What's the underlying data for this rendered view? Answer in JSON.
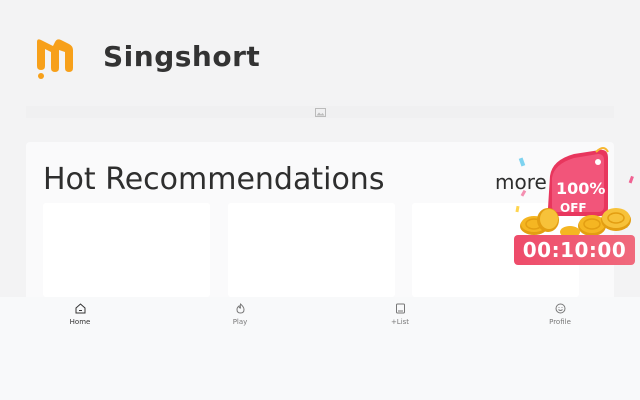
{
  "app": {
    "name": "Singshort"
  },
  "section": {
    "title": "Hot Recommendations",
    "more_label": "more"
  },
  "promo": {
    "discount": "100%",
    "off_label": "OFF",
    "timer": "00:10:00"
  },
  "tabs": [
    {
      "label": "Home",
      "icon": "home-icon",
      "active": true
    },
    {
      "label": "Play",
      "icon": "flame-icon",
      "active": false
    },
    {
      "label": "+List",
      "icon": "bookmark-icon",
      "active": false
    },
    {
      "label": "Profile",
      "icon": "smile-icon",
      "active": false
    }
  ],
  "colors": {
    "brand": "#f7a01a",
    "timer_bg": "#ee4b6a",
    "badge": "#e8365d",
    "coin": "#f5b622"
  }
}
